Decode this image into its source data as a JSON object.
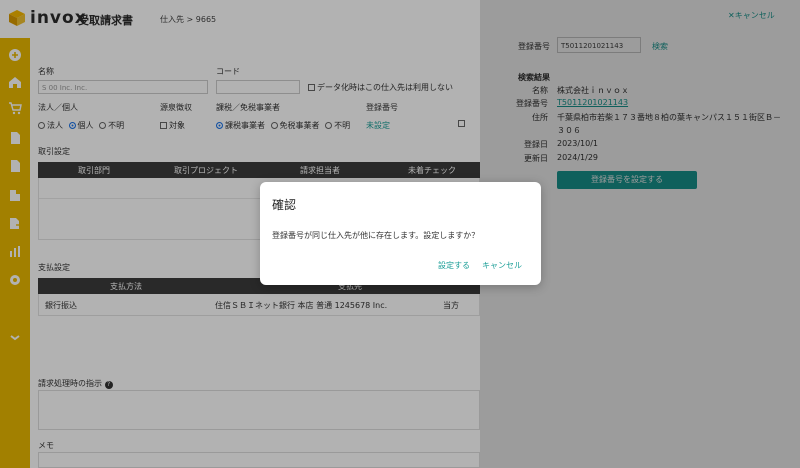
{
  "header": {
    "logo_text": "invox",
    "logo_sub": "受取請求書",
    "breadcrumb": "仕入先 > 9665"
  },
  "sidebar": {
    "icons": [
      "add-icon",
      "home-icon",
      "cart-icon",
      "document-icon",
      "document-icon",
      "building-icon",
      "export-icon",
      "chart-icon",
      "gear-icon",
      "link-icon"
    ]
  },
  "form": {
    "name_label": "名称",
    "name_value": "S 00 Inc. Inc.",
    "code_label": "コード",
    "code_value": "",
    "no_digitize_label": "データ化時はこの仕入先は利用しない",
    "entity_label": "法人／個人",
    "entity_options": [
      "法人",
      "個人",
      "不明"
    ],
    "withholding_label": "源泉徴収",
    "withholding_option": "対象",
    "tax_label": "課税／免税事業者",
    "tax_options": [
      "課税事業者",
      "免税事業者",
      "不明"
    ],
    "reg_label": "登録番号",
    "reg_value": "未設定"
  },
  "torihiki": {
    "section_label": "取引設定",
    "columns": [
      "取引部門",
      "取引プロジェクト",
      "請求担当者",
      "未着チェック"
    ]
  },
  "payment": {
    "section_label": "支払設定",
    "columns": [
      "支払方法",
      "支払先"
    ],
    "row": {
      "method": "銀行振込",
      "dest": "住信ＳＢＩネット銀行 本店 普通 1245678 Inc.",
      "extra": "当方"
    }
  },
  "instruction_label": "請求処理時の指示",
  "memo_label": "メモ",
  "panel": {
    "cancel_label": "キャンセル",
    "reg_label": "登録番号",
    "reg_input": "T5011201021143",
    "search_label": "検索",
    "result_title": "検索結果",
    "result_rows": [
      {
        "key": "名称",
        "value": "株式会社ｉｎｖｏｘ"
      },
      {
        "key": "登録番号",
        "value": "T5011201021143"
      },
      {
        "key": "住所",
        "value": "千葉県柏市若柴１７３番地８柏の葉キャンパス１５１街区Ｂ－"
      },
      {
        "key": "",
        "value": "３０６"
      },
      {
        "key": "登録日",
        "value": "2023/10/1"
      },
      {
        "key": "更新日",
        "value": "2024/1/29"
      }
    ],
    "set_button": "登録番号を設定する"
  },
  "dialog": {
    "title": "確認",
    "message": "登録番号が同じ仕入先が他に存在します。設定しますか？",
    "confirm": "設定する",
    "cancel": "キャンセル"
  },
  "colors": {
    "teal": "#1a9e97",
    "sidebar": "#e8b800",
    "table_head": "#3c3c3c"
  }
}
